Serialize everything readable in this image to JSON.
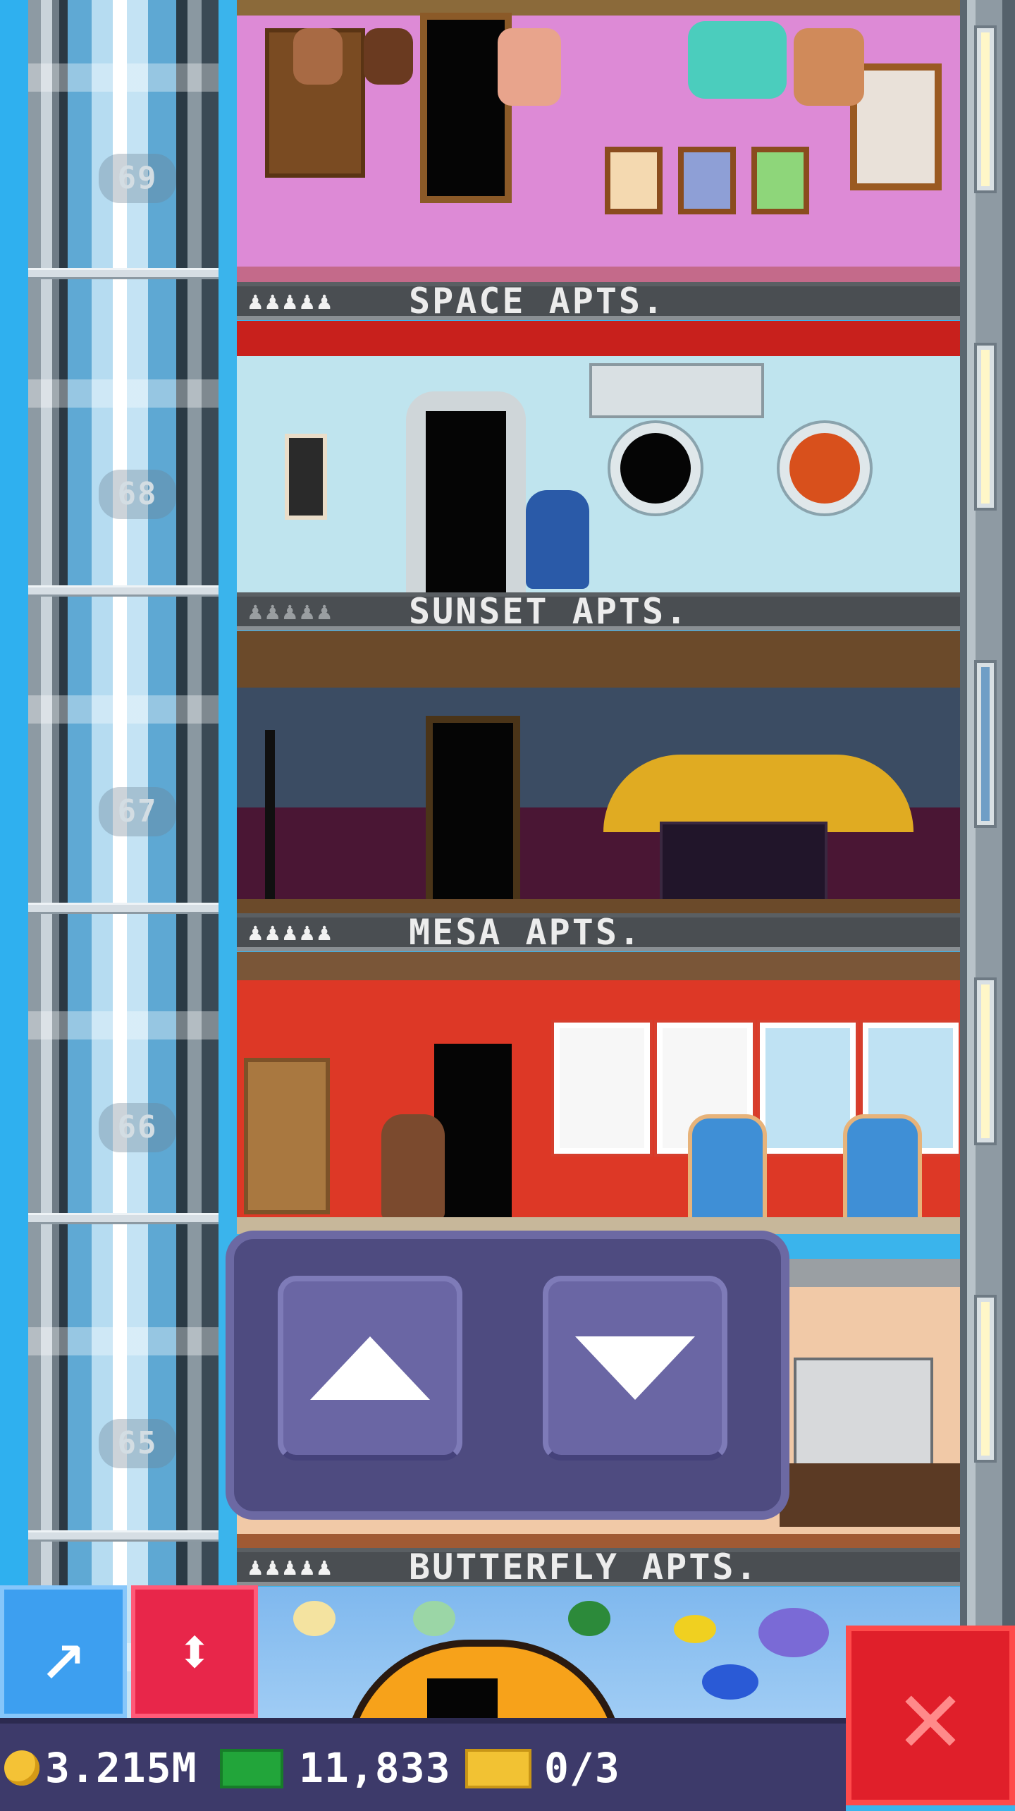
{
  "floors": [
    {
      "number": "69",
      "name": ""
    },
    {
      "number": "68",
      "name": "SPACE APTS."
    },
    {
      "number": "67",
      "name": "SUNSET APTS."
    },
    {
      "number": "66",
      "name": "MESA APTS."
    },
    {
      "number": "65",
      "name": ""
    }
  ],
  "labels": {
    "space": "SPACE APTS.",
    "sunset": "SUNSET APTS.",
    "mesa": "MESA APTS.",
    "butterfly": "BUTTERFLY APTS.",
    "people": "♟♟♟♟♟"
  },
  "shaft_numbers": [
    "69",
    "68",
    "67",
    "66",
    "65"
  ],
  "status": {
    "coins": "3.215M",
    "bux": "11,833",
    "tickets": "0/3"
  },
  "controls": {
    "up": "up-arrow-icon",
    "down": "down-arrow-icon",
    "move": "arrow-icon",
    "scroll": "up-down-icon",
    "close": "close-icon"
  },
  "colors": {
    "panel": "#4e4b80",
    "close": "#e01f2a",
    "scroll": "#e8264a",
    "move": "#3d9ff0"
  }
}
